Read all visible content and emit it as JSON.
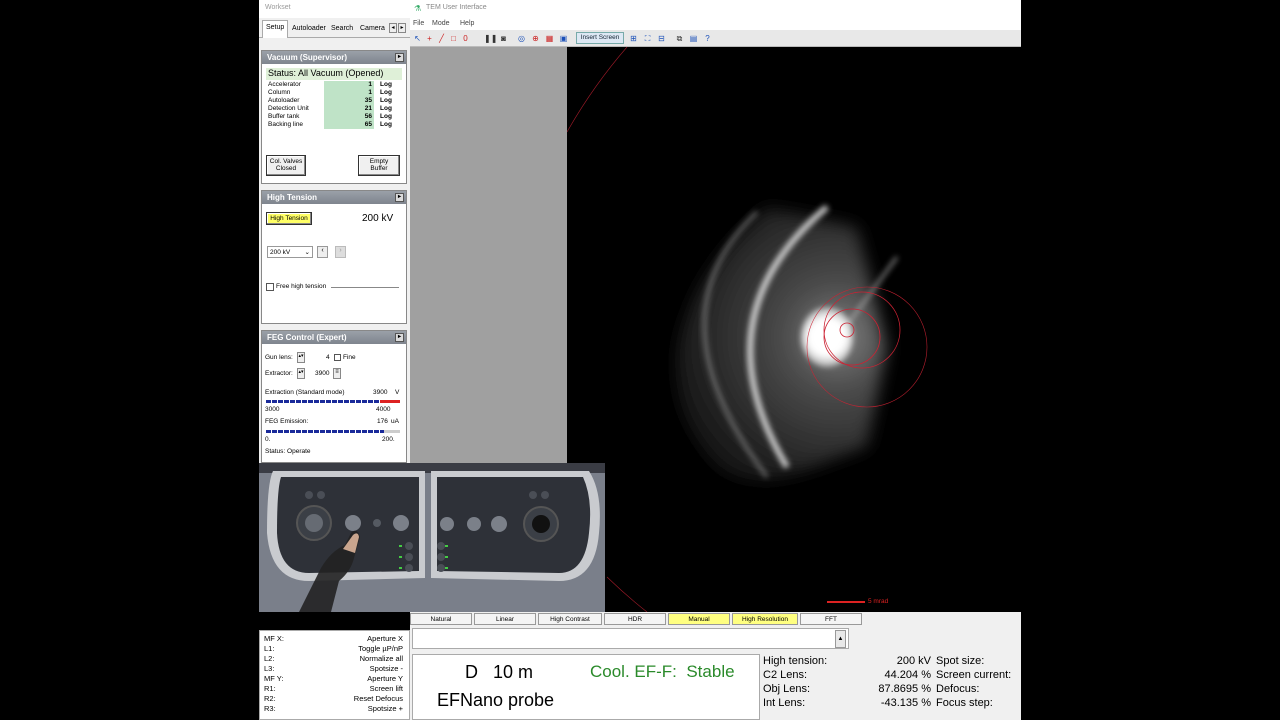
{
  "workset": {
    "title": "Workset",
    "tabs": [
      "Setup",
      "Autoloader",
      "Search",
      "Camera"
    ],
    "tab_scroll_left": "◂",
    "tab_scroll_right": "▸"
  },
  "vacuum": {
    "header": "Vacuum (Supervisor)",
    "status": "Status: All Vacuum (Opened)",
    "rows": [
      {
        "name": "Accelerator",
        "value": "1",
        "unit": "Log"
      },
      {
        "name": "Column",
        "value": "1",
        "unit": "Log"
      },
      {
        "name": "Autoloader",
        "value": "35",
        "unit": "Log"
      },
      {
        "name": "Detection Unit",
        "value": "21",
        "unit": "Log"
      },
      {
        "name": "Buffer tank",
        "value": "56",
        "unit": "Log"
      },
      {
        "name": "Backing line",
        "value": "65",
        "unit": "Log"
      }
    ],
    "col_valves_line1": "Col. Valves",
    "col_valves_line2": "Closed",
    "empty_buffer_line1": "Empty",
    "empty_buffer_line2": "Buffer"
  },
  "high_tension": {
    "header": "High Tension",
    "button": "High Tension",
    "value": "200 kV",
    "select_value": "200 kV",
    "free_label": "Free high tension"
  },
  "feg": {
    "header": "FEG Control (Expert)",
    "gun_lens_label": "Gun lens:",
    "gun_lens_value": "4",
    "fine_label": "Fine",
    "extractor_label": "Extractor:",
    "extractor_value": "3900",
    "extraction_label": "Extraction (Standard mode)",
    "extraction_value": "3900",
    "extraction_unit": "V",
    "extraction_min": "3000",
    "extraction_max": "4000",
    "emission_label": "FEG Emission:",
    "emission_value": "176",
    "emission_unit": "uA",
    "emission_min": "0.",
    "emission_max": "200.",
    "status": "Status: Operate"
  },
  "app": {
    "title": "TEM User Interface",
    "menu": [
      "File",
      "Mode",
      "Help"
    ],
    "insert_screen": "Insert Screen",
    "scale_bar_label": "5 mrad"
  },
  "modes": [
    {
      "label": "Natural",
      "active": false
    },
    {
      "label": "Linear",
      "active": false
    },
    {
      "label": "High Contrast",
      "active": false
    },
    {
      "label": "HDR",
      "active": false
    },
    {
      "label": "Manual",
      "active": true
    },
    {
      "label": "High Resolution",
      "active": true
    },
    {
      "label": "FFT",
      "active": false
    }
  ],
  "button_map": [
    {
      "key": "MF X:",
      "value": "Aperture X"
    },
    {
      "key": "L1:",
      "value": "Toggle µP/nP"
    },
    {
      "key": "L2:",
      "value": "Normalize all"
    },
    {
      "key": "L3:",
      "value": "Spotsize -"
    },
    {
      "key": "MF Y:",
      "value": "Aperture Y"
    },
    {
      "key": "R1:",
      "value": "Screen lift"
    },
    {
      "key": "R2:",
      "value": "Reset Defocus"
    },
    {
      "key": "R3:",
      "value": "Spotsize +"
    }
  ],
  "readout": {
    "mode_letter": "D",
    "camera_length": "10 m",
    "probe": "EFNano probe",
    "cool_status": "Cool. EF-F:  Stable",
    "rows_left": [
      {
        "label": "High tension:",
        "value": "200 kV"
      },
      {
        "label": "C2 Lens:",
        "value": "44.204 %"
      },
      {
        "label": "Obj Lens:",
        "value": "87.8695 %"
      },
      {
        "label": "Int Lens:",
        "value": "-43.135 %"
      }
    ],
    "rows_right": [
      "Spot size:",
      "Screen current:",
      "Defocus:",
      "Focus step:"
    ]
  },
  "colors": {
    "panel_head": "#8a9099",
    "vacuum_green": "#bfe3c7",
    "active_mode": "#ffff80",
    "status_green": "#2a8a2a"
  }
}
